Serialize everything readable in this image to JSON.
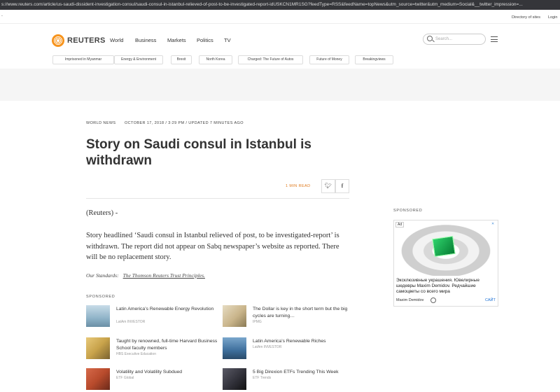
{
  "browser": {
    "url": "s://www.reuters.com/article/us-saudi-dissident-investigation-consul/saudi-consul-in-istanbul-relieved-of-post-to-be-investigated-report-idUSKCN1MR1SG?feedType=RSS&feedName=topNews&utm_source=twitter&utm_medium=Social&__twitter_impression=..."
  },
  "topbar": {
    "dash": "-",
    "directory": "Directory of sites",
    "login": "Login"
  },
  "nav": {
    "brand": "REUTERS",
    "links": [
      "World",
      "Business",
      "Markets",
      "Politics",
      "TV"
    ],
    "search_placeholder": "Search..."
  },
  "topics": [
    "Imprisoned in Myanmar",
    "Energy & Environment",
    "Brexit",
    "North Korea",
    "Charged: The Future of Autos",
    "Future of Money",
    "Breakingviews"
  ],
  "article": {
    "section": "World News",
    "date": "October 17, 2018 / 3:29 PM / Updated 7 minutes ago",
    "headline": "Story on Saudi consul in Istanbul is withdrawn",
    "read_time": "1 MIN READ",
    "dateline": "(Reuters) -",
    "paragraph": "Story headlined ‘Saudi consul in Istanbul relieved of post, to be investigated-report’ is withdrawn. The report did not appear on Sabq newspaper’s website as reported. There will be no replacement story.",
    "standards_label": "Our Standards:",
    "standards_link": "The Thomson Reuters Trust Principles."
  },
  "sponsored": {
    "label": "SPONSORED",
    "items": [
      {
        "title": "Latin America’s Renewable Energy Revolution",
        "source": "LatAm INVESTOR",
        "color": "#8fb3c8"
      },
      {
        "title": "The Dollar is key in the short term but the big cycles are turning…",
        "source": "IPMG",
        "color": "#c9b48a"
      },
      {
        "title": "Taught by renowned, full-time Harvard Business School faculty members",
        "source": "HBS Executive Education",
        "color": "#c7a24a"
      },
      {
        "title": "Latin America’s Renewable Riches",
        "source": "LatAm INVESTOR",
        "color": "#3e6f9c"
      },
      {
        "title": "Volatility and Volatility Subdued",
        "source": "ETF Global",
        "color": "#b84a2c"
      },
      {
        "title": "5 Big Direxion ETFs Trending This Week",
        "source": "ETF Trends",
        "color": "#2d2d35"
      }
    ]
  },
  "sidebar_ad": {
    "label": "SPONSORED",
    "badge": "Ad",
    "close": "✕",
    "text": "Эксклюзивные украшения. Ювелирные шедевры Maxim Demidov. Редчайшие самоцветы со всего мира",
    "brand": "Maxim Demidov",
    "cta": "САЙТ",
    "gem_color": "#1fa84f"
  }
}
